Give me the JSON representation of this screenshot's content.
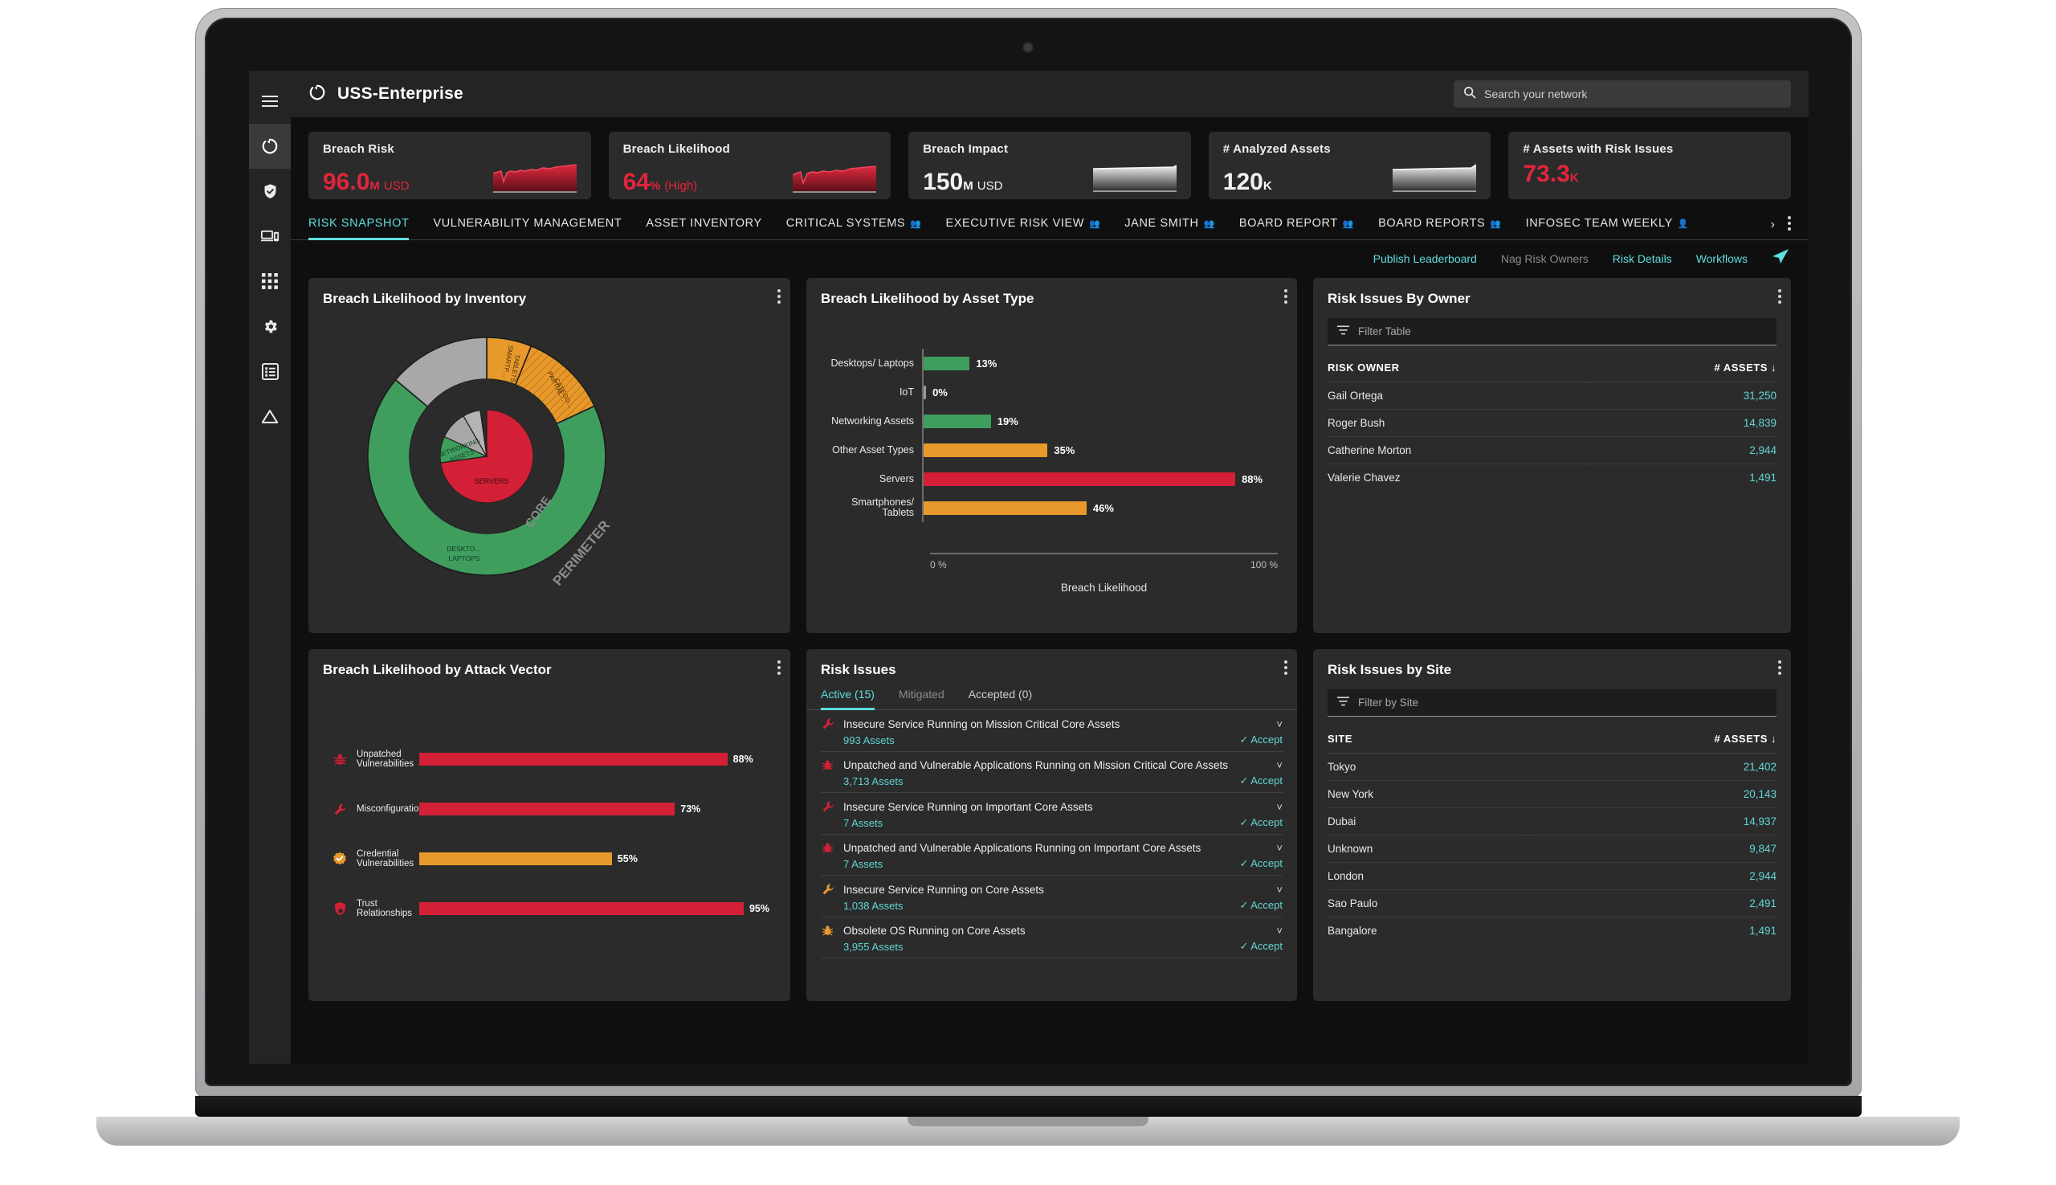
{
  "device": {
    "label": "MacBook"
  },
  "sidebar": {
    "items": [
      {
        "name": "menu-icon",
        "label": "Menu"
      },
      {
        "name": "dashboard-icon",
        "label": "Dashboard"
      },
      {
        "name": "shield-check-icon",
        "label": "Security"
      },
      {
        "name": "devices-icon",
        "label": "Devices"
      },
      {
        "name": "grid-apps-icon",
        "label": "Apps"
      },
      {
        "name": "gear-icon",
        "label": "Settings"
      },
      {
        "name": "list-icon",
        "label": "Reports"
      },
      {
        "name": "warning-triangle-icon",
        "label": "Alerts"
      }
    ]
  },
  "header": {
    "title": "USS-Enterprise",
    "logo_icon": "circle-arc-icon",
    "search": {
      "placeholder": "Search your network",
      "value": "",
      "icon": "search-icon"
    }
  },
  "kpis": [
    {
      "title": "Breach Risk",
      "value": "96.0",
      "unit": "M",
      "suffix": "USD",
      "color": "red",
      "spark": "red"
    },
    {
      "title": "Breach Likelihood",
      "value": "64",
      "unit": "%",
      "suffix": "(High)",
      "color": "red",
      "spark": "red"
    },
    {
      "title": "Breach Impact",
      "value": "150",
      "unit": "M",
      "suffix": "USD",
      "color": "white",
      "spark": "gray"
    },
    {
      "title": "# Analyzed Assets",
      "value": "120",
      "unit": "K",
      "suffix": "",
      "color": "white",
      "spark": "gray"
    },
    {
      "title": "# Assets with Risk Issues",
      "value": "73.3",
      "unit": "K",
      "suffix": "",
      "color": "red",
      "spark": "none"
    }
  ],
  "tabs": [
    {
      "label": "RISK SNAPSHOT",
      "active": true,
      "shared": false
    },
    {
      "label": "VULNERABILITY MANAGEMENT",
      "active": false,
      "shared": false
    },
    {
      "label": "ASSET INVENTORY",
      "active": false,
      "shared": false
    },
    {
      "label": "CRITICAL SYSTEMS",
      "active": false,
      "shared": true
    },
    {
      "label": "EXECUTIVE RISK VIEW",
      "active": false,
      "shared": true
    },
    {
      "label": "JANE SMITH",
      "active": false,
      "shared": true
    },
    {
      "label": "BOARD REPORT",
      "active": false,
      "shared": true
    },
    {
      "label": "BOARD REPORTS",
      "active": false,
      "shared": true
    },
    {
      "label": "INFOSEC TEAM WEEKLY",
      "active": false,
      "shared": true
    }
  ],
  "tab_overflow_icon": "chevron-right-icon",
  "tab_kebab_icon": "kebab-menu-icon",
  "actions": [
    {
      "label": "Publish Leaderboard",
      "muted": false
    },
    {
      "label": "Nag Risk Owners",
      "muted": true
    },
    {
      "label": "Risk Details",
      "muted": false
    },
    {
      "label": "Workflows",
      "muted": false
    }
  ],
  "action_send_icon": "send-paper-plane-icon",
  "panels": {
    "inventory": {
      "title": "Breach Likelihood by Inventory"
    },
    "asset_type": {
      "title": "Breach Likelihood by Asset Type"
    },
    "owner": {
      "title": "Risk Issues By Owner"
    },
    "attack": {
      "title": "Breach Likelihood by Attack Vector"
    },
    "issues": {
      "title": "Risk Issues"
    },
    "site": {
      "title": "Risk Issues by Site"
    }
  },
  "chart_data": [
    {
      "type": "pie",
      "id": "breach-likelihood-by-inventory",
      "title": "Breach Likelihood by Inventory",
      "rings": [
        {
          "name": "CORE",
          "ring_label": "CORE",
          "slices": [
            {
              "label": "SERVERS",
              "value": 72,
              "color": "#d32036"
            },
            {
              "label": "NETWORKING ASSETS",
              "value": 9,
              "color": "#3f9e5e"
            },
            {
              "label": "",
              "value": 12,
              "color": "#a8a8a8"
            },
            {
              "label": "",
              "value": 7,
              "color": "#a8a8a8"
            }
          ]
        },
        {
          "name": "PERIMETER",
          "ring_label": "PERIMETER",
          "slices": [
            {
              "label": "SMARTP… TABLETS",
              "value": 6,
              "color": "#e8992c"
            },
            {
              "label": "PARTIAL… CATEGO…",
              "value": 12,
              "color": "#e8992c",
              "hatched": true
            },
            {
              "label": "DESKTO… LAPTOPS",
              "value": 70,
              "color": "#3f9e5e"
            },
            {
              "label": "",
              "value": 12,
              "color": "#a8a8a8"
            }
          ]
        }
      ]
    },
    {
      "type": "bar",
      "id": "breach-likelihood-by-asset-type",
      "orientation": "horizontal",
      "title": "Breach Likelihood by Asset Type",
      "xlabel": "Breach Likelihood",
      "ylabel": "",
      "xlim": [
        0,
        100
      ],
      "xticks": [
        "0 %",
        "100 %"
      ],
      "categories": [
        "Desktops/ Laptops",
        "IoT",
        "Networking Assets",
        "Other Asset Types",
        "Servers",
        "Smartphones/ Tablets"
      ],
      "values": [
        13,
        0,
        19,
        35,
        88,
        46
      ],
      "value_labels": [
        "13%",
        "0%",
        "19%",
        "35%",
        "88%",
        "46%"
      ],
      "colors": [
        "#3f9e5e",
        "#9a9a9a",
        "#3f9e5e",
        "#e8992c",
        "#d32036",
        "#e8992c"
      ]
    },
    {
      "type": "bar",
      "id": "breach-likelihood-by-attack-vector",
      "orientation": "horizontal",
      "title": "Breach Likelihood by Attack Vector",
      "xlim": [
        0,
        100
      ],
      "categories": [
        "Unpatched Vulnerabilities",
        "Misconfigurations",
        "Credential Vulnerabilities",
        "Trust Relationships"
      ],
      "values": [
        88,
        73,
        55,
        95
      ],
      "value_labels": [
        "88%",
        "73%",
        "55%",
        "95%"
      ],
      "colors": [
        "#d32036",
        "#d32036",
        "#e8992c",
        "#d32036"
      ],
      "icons": [
        "bug-icon",
        "wrench-icon",
        "badge-check-icon",
        "shield-key-icon"
      ],
      "icon_colors": [
        "#d32036",
        "#d32036",
        "#e8992c",
        "#d32036"
      ]
    }
  ],
  "owner_table": {
    "filter": {
      "placeholder": "Filter Table",
      "value": "",
      "icon": "filter-icon"
    },
    "columns": [
      "RISK OWNER",
      "# ASSETS"
    ],
    "sort_icon": "arrow-down-icon",
    "rows": [
      {
        "owner": "Gail Ortega",
        "assets": "31,250"
      },
      {
        "owner": "Roger Bush",
        "assets": "14,839"
      },
      {
        "owner": "Catherine Morton",
        "assets": "2,944"
      },
      {
        "owner": "Valerie Chavez",
        "assets": "1,491"
      }
    ]
  },
  "site_table": {
    "filter": {
      "placeholder": "Filter by Site",
      "value": "",
      "icon": "filter-icon"
    },
    "columns": [
      "SITE",
      "# ASSETS"
    ],
    "sort_icon": "arrow-down-icon",
    "rows": [
      {
        "site": "Tokyo",
        "assets": "21,402"
      },
      {
        "site": "New York",
        "assets": "20,143"
      },
      {
        "site": "Dubai",
        "assets": "14,937"
      },
      {
        "site": "Unknown",
        "assets": "9,847"
      },
      {
        "site": "London",
        "assets": "2,944"
      },
      {
        "site": "Sao Paulo",
        "assets": "2,491"
      },
      {
        "site": "Bangalore",
        "assets": "1,491"
      }
    ]
  },
  "risk_issues": {
    "tabs": [
      {
        "label": "Active (15)",
        "active": true,
        "muted": false
      },
      {
        "label": "Mitigated",
        "active": false,
        "muted": true
      },
      {
        "label": "Accepted (0)",
        "active": false,
        "muted": false
      }
    ],
    "accept_label": "Accept",
    "accept_icon": "check-icon",
    "expand_icon": "chevron-down-icon",
    "items": [
      {
        "icon": "wrench-icon",
        "icon_color": "#d32036",
        "name": "Insecure Service Running on Mission Critical Core Assets",
        "assets": "993 Assets"
      },
      {
        "icon": "bug-icon",
        "icon_color": "#d32036",
        "name": "Unpatched and Vulnerable Applications Running on Mission Critical Core Assets",
        "assets": "3,713 Assets"
      },
      {
        "icon": "wrench-icon",
        "icon_color": "#d32036",
        "name": "Insecure Service Running on Important Core Assets",
        "assets": "7 Assets"
      },
      {
        "icon": "bug-icon",
        "icon_color": "#d32036",
        "name": "Unpatched and Vulnerable Applications Running on Important Core Assets",
        "assets": "7 Assets"
      },
      {
        "icon": "wrench-icon",
        "icon_color": "#e8992c",
        "name": "Insecure Service Running on Core Assets",
        "assets": "1,038 Assets"
      },
      {
        "icon": "bug-icon",
        "icon_color": "#e8992c",
        "name": "Obsolete OS Running on Core Assets",
        "assets": "3,955 Assets"
      }
    ]
  },
  "colors": {
    "accent_teal": "#5fdede",
    "danger_red": "#d32036",
    "warning_orange": "#e8992c",
    "ok_green": "#3f9e5e",
    "neutral_gray": "#9a9a9a",
    "panel_bg": "#2b2b2b",
    "app_bg": "#0f0f0f"
  }
}
